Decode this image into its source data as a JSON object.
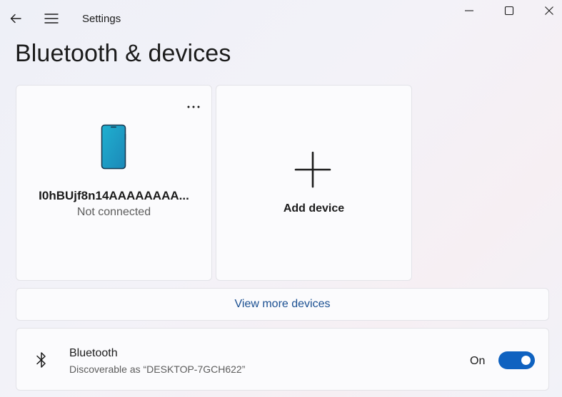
{
  "window": {
    "title": "Settings",
    "controls": [
      "minimize",
      "maximize",
      "close"
    ]
  },
  "page": {
    "title": "Bluetooth & devices"
  },
  "devices": [
    {
      "name": "I0hBUjf8n14AAAAAAAA...",
      "status": "Not connected",
      "icon": "phone-icon",
      "more_icon": "more-dots-icon"
    }
  ],
  "add_device": {
    "label": "Add device",
    "icon": "plus-icon"
  },
  "view_more": {
    "label": "View more devices"
  },
  "bluetooth": {
    "title": "Bluetooth",
    "subtitle": "Discoverable as “DESKTOP-7GCH622”",
    "state_label": "On",
    "enabled": true,
    "icon": "bluetooth-icon"
  },
  "colors": {
    "accent": "#0f62c0",
    "link": "#1a4f91",
    "phone": "#2aa3c9"
  }
}
